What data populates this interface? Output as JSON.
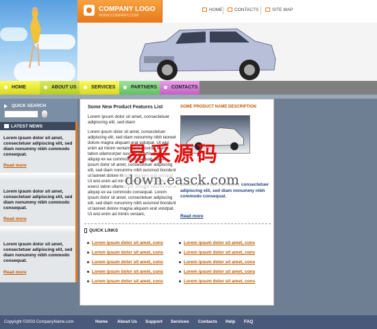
{
  "header": {
    "logo_title": "COMPANY LOGO",
    "logo_sub": "WWW.COMPANY.COM",
    "topnav": {
      "home": "HOME",
      "contacts": "CONTACTS",
      "sitemap": "SITE MAP"
    }
  },
  "nav": [
    "HOME",
    "ABOUT US",
    "SERVICES",
    "PARTNERS",
    "CONTACTS"
  ],
  "quick_search": {
    "title": "QUICK SEARCH",
    "value": ""
  },
  "latest_news": {
    "title": "LATEST NEWS",
    "items": [
      {
        "text": "Lorem ipsum dolor sit amet, consectetuer adipiscing elit, sed diam nonummy nibh commodo consequat.",
        "link": "Read more"
      },
      {
        "text": "Lorem ipsum dolor sit amet, consectetuer adipiscing elit, sed diam nonummy nibh commodo consequat.",
        "link": "Read more"
      },
      {
        "text": "Lorem ipsum dolor sit amet, consectetuer adipiscing elit, sed diam nonummy nibh commodo consequat.",
        "link": "Read more"
      }
    ]
  },
  "main": {
    "col1_title": "Some New Product Features List",
    "col1_intro": "Lorem ipsum dolor sit amet, consectetuer adipiscing elit, sed diam",
    "col1_body": "Lorem ipsum dolor sit amet, consectetuer adipiscing elit, sed diam nonummy nibh laoreet dolore magna aliquam erat volutpat. Ut wisi enim ad minim veniam, quis nostrud exerci tation ullamcorper suscipit lobortis nisl ut aliquip ex ea commodo consequat. Lorem ipsum dolor sit amet, consectetuer adipiscing elit, sed diam nonummy nibh euismod tincidunt ut laoreet dolore magna aliquam erat volutpat. Ut wisi enim ad minim veniam, quis nostrud exerci tation ullamcorper suscipit lobortis nisl ut aliquip ex ea commodo consequat. Lorem ipsum dolor sit amet, consectetuer adipiscing elit, sed diam nonummy nibh euismod tincidunt ut laoreet dolore magna aliquam erat volutpat. Ut wisi enim ad minim veniam,",
    "col2_title": "SOME PRODUCT NAME DESCRIPTION",
    "col2_text": "Lorem ipsum dolor sit amet, consectetuer adipiscing elit, sed diam nonummy nibh commodo consequat.",
    "col2_readmore": "Read more",
    "quick_links_title": "QUICK LINKS",
    "quick_links": [
      "Lorem ipsum dolor sit amet, cons",
      "Lorem ipsum dolor sit amet, cons",
      "Lorem ipsum dolor sit amet, cons",
      "Lorem ipsum dolor sit amet, cons",
      "Lorem ipsum dolor sit amet, cons",
      "Lorem ipsum dolor sit amet, cons",
      "Lorem ipsum dolor sit amet, cons",
      "Lorem ipsum dolor sit amet, cons",
      "Lorem ipsum dolor sit amet, cons",
      "Lorem ipsum dolor sit amet, cons"
    ]
  },
  "watermark": {
    "cn": "易采源码",
    "url": "down.easck.com"
  },
  "footer": {
    "copyright": "Copyright ©2003 CompanyName.com",
    "links": [
      "Home",
      "About Us",
      "Support",
      "Services",
      "Contacts",
      "Help",
      "FAQ"
    ]
  },
  "colors": {
    "accent": "#e8781a",
    "footer": "#49597a",
    "link": "#c05a00"
  }
}
